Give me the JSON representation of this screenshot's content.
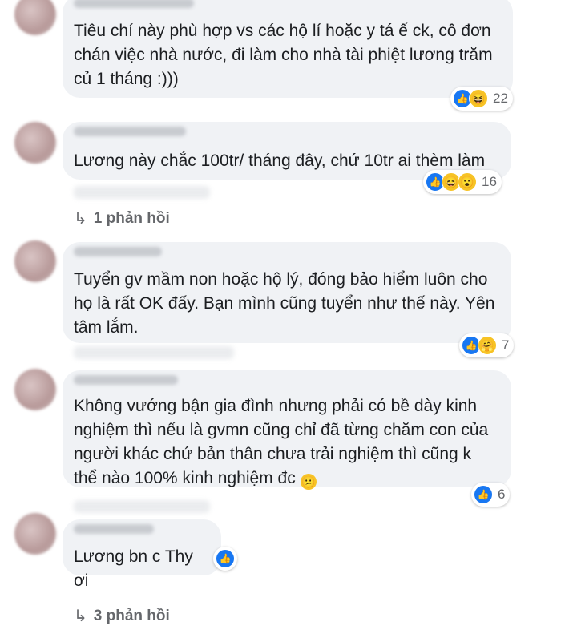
{
  "comments": [
    {
      "text": "Tiêu chí này phù hợp vs các hộ lí hoặc y tá ế ck, cô đơn\nchán việc nhà nước, đi làm cho nhà tài phiệt lương trăm\ncủ 1 tháng :)))",
      "reaction_count": "22",
      "reaction_icons": [
        "like-icon",
        "haha-icon"
      ]
    },
    {
      "text": "Lương này chắc 100tr/ tháng đây, chứ 10tr ai thèm làm",
      "reaction_count": "16",
      "reaction_icons": [
        "like-icon",
        "haha-icon",
        "wow-icon"
      ],
      "replies_label": "1 phản hồi"
    },
    {
      "text": "Tuyển gv mầm non hoặc hộ lý, đóng bảo hiểm luôn cho\nhọ là rất OK đấy. Bạn mình cũng tuyển như thế này. Yên\ntâm lắm.",
      "reaction_count": "7",
      "reaction_icons": [
        "like-icon",
        "care-icon"
      ]
    },
    {
      "text": "Không vướng bận gia đình nhưng phải có bề dày kinh\nnghiệm thì nếu là gvmn cũng chỉ đã từng chăm con của\nngười khác chứ bản thân chưa trải nghiệm thì cũng k\nthể nào 100% kinh nghiệm đc",
      "reaction_count": "6",
      "reaction_icons": [
        "like-icon"
      ],
      "inline_emoji": "confused-face-icon"
    },
    {
      "text": "Lương bn c Thy ơi",
      "reaction_icons": [
        "like-icon"
      ],
      "replies_label": "3 phản hồi"
    }
  ],
  "colors": {
    "bubble": "#f0f2f5",
    "text": "#1c1e21",
    "secondary": "#65676b",
    "like": "#1877f2",
    "emoji": "#f7c325"
  }
}
